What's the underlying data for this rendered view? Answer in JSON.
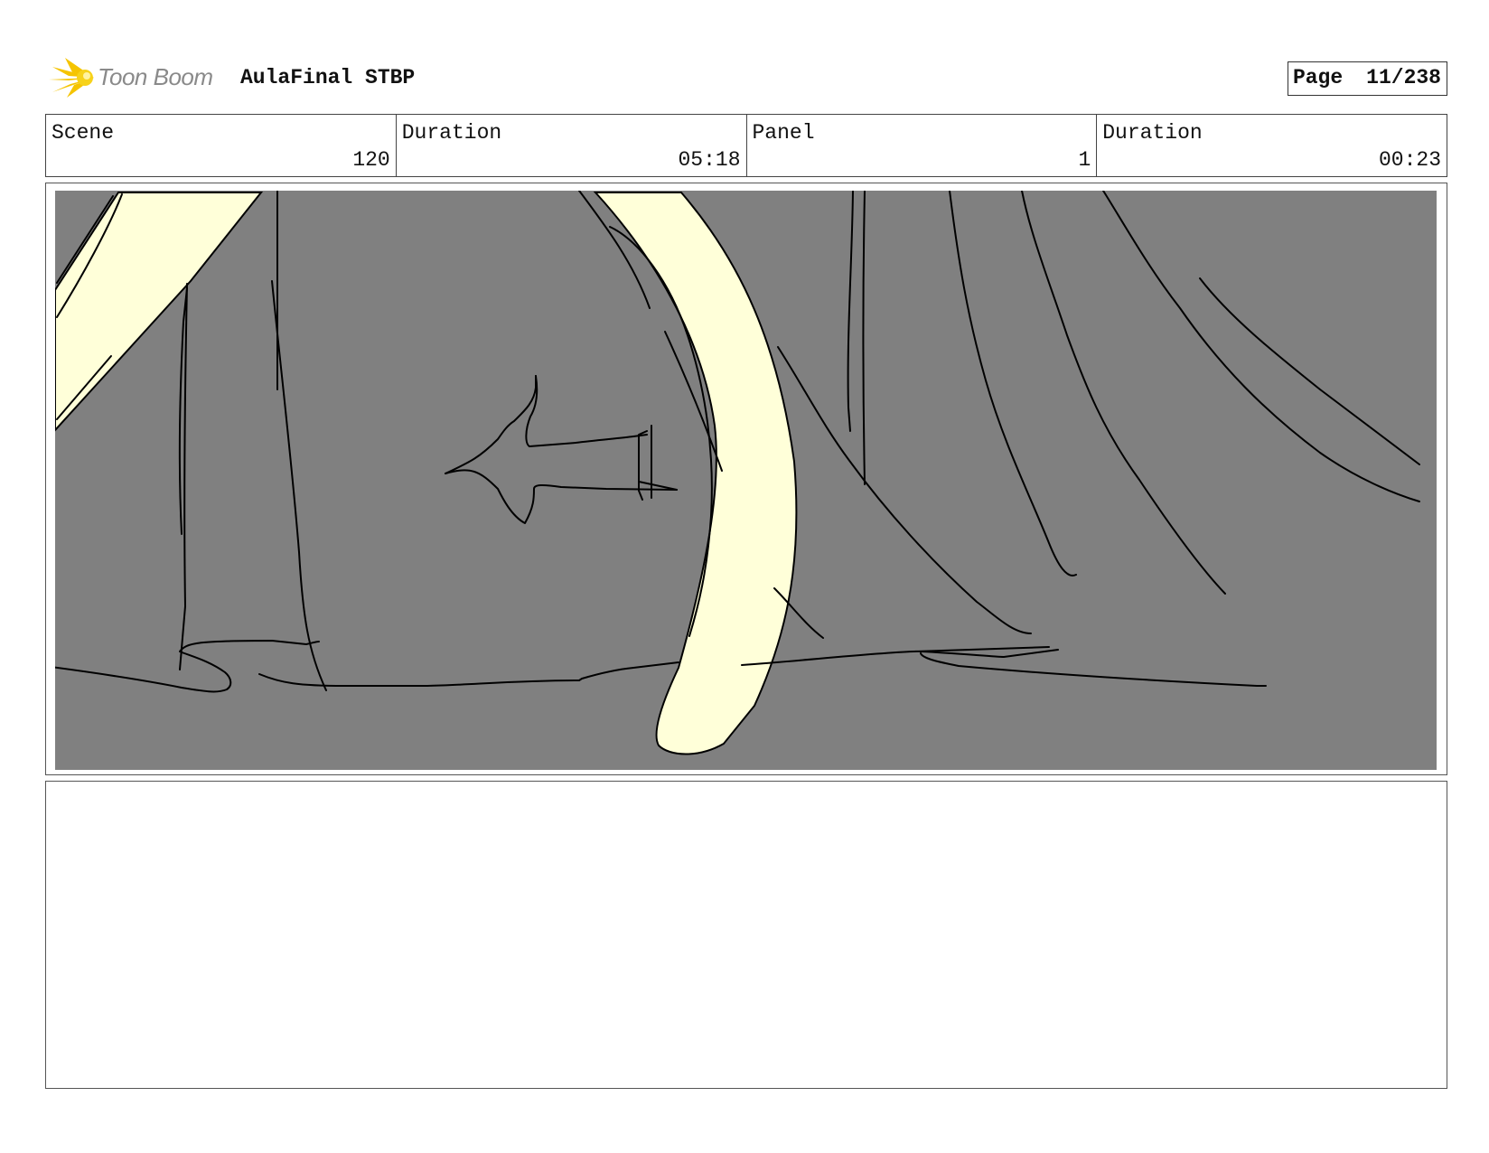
{
  "header": {
    "brand": "Toon Boom",
    "project_title": "AulaFinal STBP",
    "page_label": "Page",
    "page_value": "11/238"
  },
  "info": {
    "scene_label": "Scene",
    "scene_value": "120",
    "scene_duration_label": "Duration",
    "scene_duration_value": "05:18",
    "panel_label": "Panel",
    "panel_value": "1",
    "panel_duration_label": "Duration",
    "panel_duration_value": "00:23"
  },
  "panel": {
    "background_color": "#808080",
    "highlight_color": "#FFFFD9",
    "line_color": "#000000"
  },
  "notes": {
    "text": ""
  }
}
